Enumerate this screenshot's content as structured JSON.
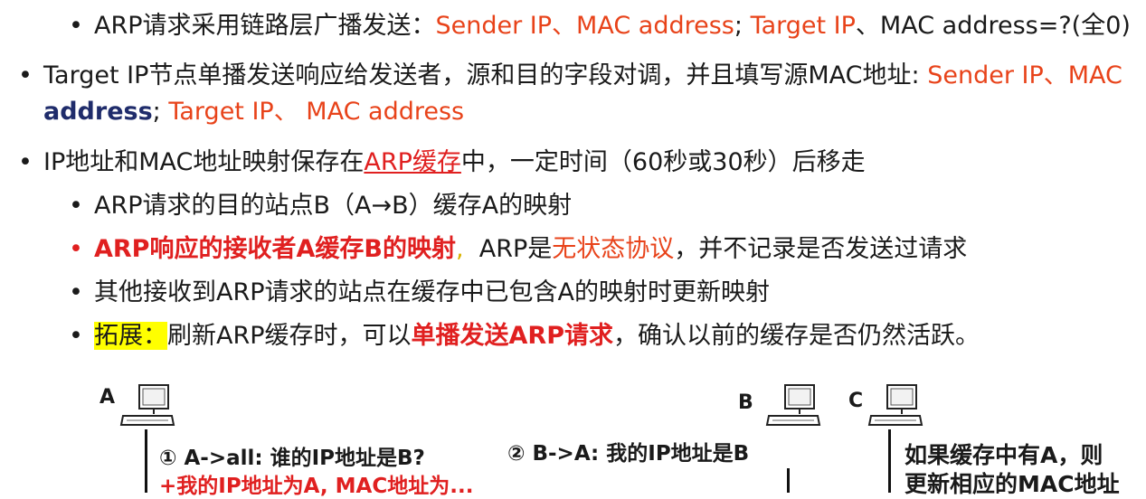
{
  "bullets": {
    "l1": {
      "prefix": "ARP请求采用链路层广播发送：",
      "sender": "Sender IP、MAC address",
      "sep": ";",
      "target": "Target IP",
      "rest": "、MAC address=?(全0)"
    },
    "l2": {
      "prefix": "Target IP节点单播发送响应给发送者，源和目的字段对调，并且填写源MAC地址:",
      "sender": "Sender IP、MAC",
      "address": "address",
      "sep": ";",
      "target": "Target IP、 MAC address"
    },
    "l3": {
      "prefix": "IP地址和MAC地址映射保存在",
      "cache": "ARP缓存",
      "rest": "中，一定时间（60秒或30秒）后移走"
    },
    "l4": {
      "text": "ARP请求的目的站点B（A→B）缓存A的映射"
    },
    "l5": {
      "bold": "ARP响应的接收者A缓存B的映射",
      "comma": ",",
      "mid": "ARP是",
      "stateless": "无状态协议",
      "rest": "，并不记录是否发送过请求"
    },
    "l6": {
      "text": "其他接收到ARP请求的站点在缓存中已包含A的映射时更新映射"
    },
    "l7": {
      "highlight": "拓展：",
      "mid": "刷新ARP缓存时，可以",
      "bold": "单播发送ARP请求",
      "rest": "，确认以前的缓存是否仍然活跃。"
    }
  },
  "diagram": {
    "node_a": "A",
    "node_b": "B",
    "node_c": "C",
    "step1_line1": "① A->all: 谁的IP地址是B?",
    "step1_line2": "+我的IP地址为A, MAC地址为...",
    "step2": "② B->A: 我的IP地址是B",
    "note_line1": "如果缓存中有A，则",
    "note_line2": "更新相应的MAC地址"
  },
  "colors": {
    "orange_red": "#e8431a",
    "red": "#e02020",
    "navy": "#1f2c6b",
    "highlight": "#ffff00"
  }
}
